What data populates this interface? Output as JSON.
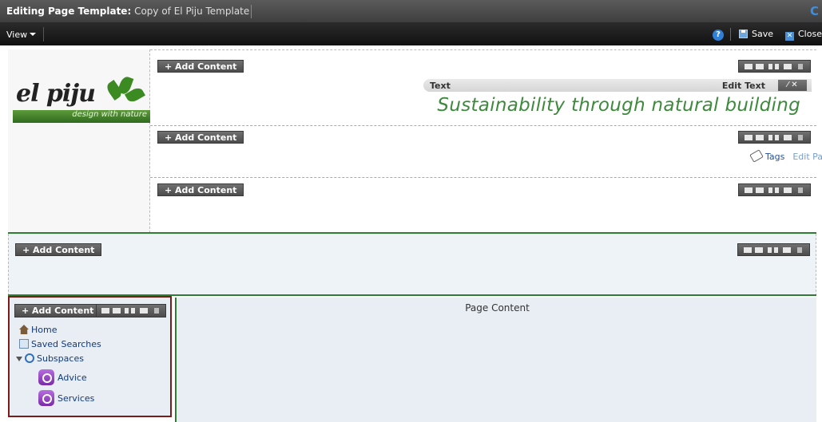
{
  "titlebar": {
    "prefix": "Editing Page Template:",
    "template_name": "Copy of El Piju Template",
    "corner": "C"
  },
  "toolbar": {
    "view_label": "View",
    "help_label": "?",
    "save_label": "Save",
    "close_label": "Close"
  },
  "header": {
    "logo_text": "el piju",
    "logo_tagline": "design with nature",
    "add_content_label": "+ Add Content",
    "text_widget": {
      "label": "Text",
      "edit_label": "Edit Text",
      "controls": "⁄ ✕",
      "slogan": "Sustainability through natural building"
    },
    "tags_label": "Tags",
    "edit_page_label": "Edit Page"
  },
  "mid_zone": {
    "add_content_label": "+ Add Content"
  },
  "sidebar": {
    "add_content_label": "+ Add Content",
    "items": [
      {
        "label": "Home",
        "icon": "home-icon"
      },
      {
        "label": "Saved Searches",
        "icon": "saved-searches-icon"
      },
      {
        "label": "Subspaces",
        "icon": "subspaces-icon"
      },
      {
        "label": "Advice",
        "icon": "space-icon"
      },
      {
        "label": "Services",
        "icon": "space-icon"
      }
    ]
  },
  "main": {
    "page_content_label": "Page Content"
  },
  "colors": {
    "accent_green": "#2e7d32",
    "slogan_green": "#3d8a3d",
    "nav_border": "#7d1a1a",
    "link_blue": "#24509a"
  }
}
